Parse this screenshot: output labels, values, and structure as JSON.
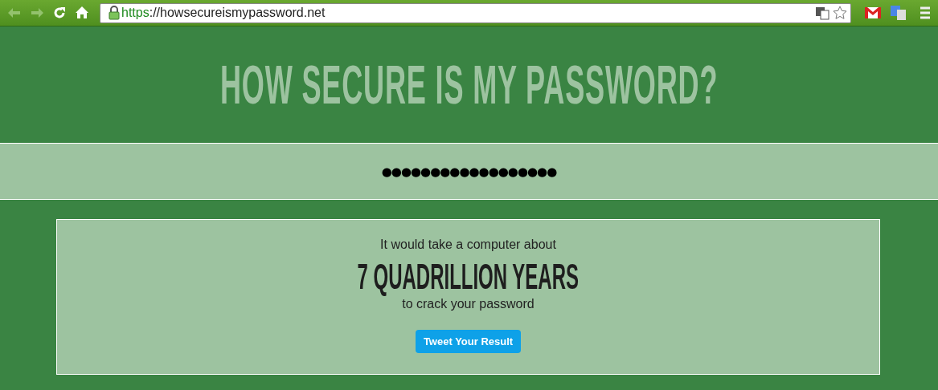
{
  "browser": {
    "nav_buttons": [
      {
        "kind": "back",
        "disabled": true
      },
      {
        "kind": "forward",
        "disabled": true
      },
      {
        "kind": "reload",
        "disabled": false
      },
      {
        "kind": "home",
        "disabled": false
      }
    ],
    "url": {
      "scheme": "https",
      "rest": "://howsecureismypassword.net"
    }
  },
  "header": {
    "title": "HOW SECURE IS MY PASSWORD?"
  },
  "password_field": {
    "value": "●●●●●●●●●●●●●●●●●●"
  },
  "result": {
    "intro": "It would take a computer about",
    "time": "7 QUADRILLION YEARS",
    "outro": "to crack your password",
    "button": "Tweet Your Result"
  }
}
